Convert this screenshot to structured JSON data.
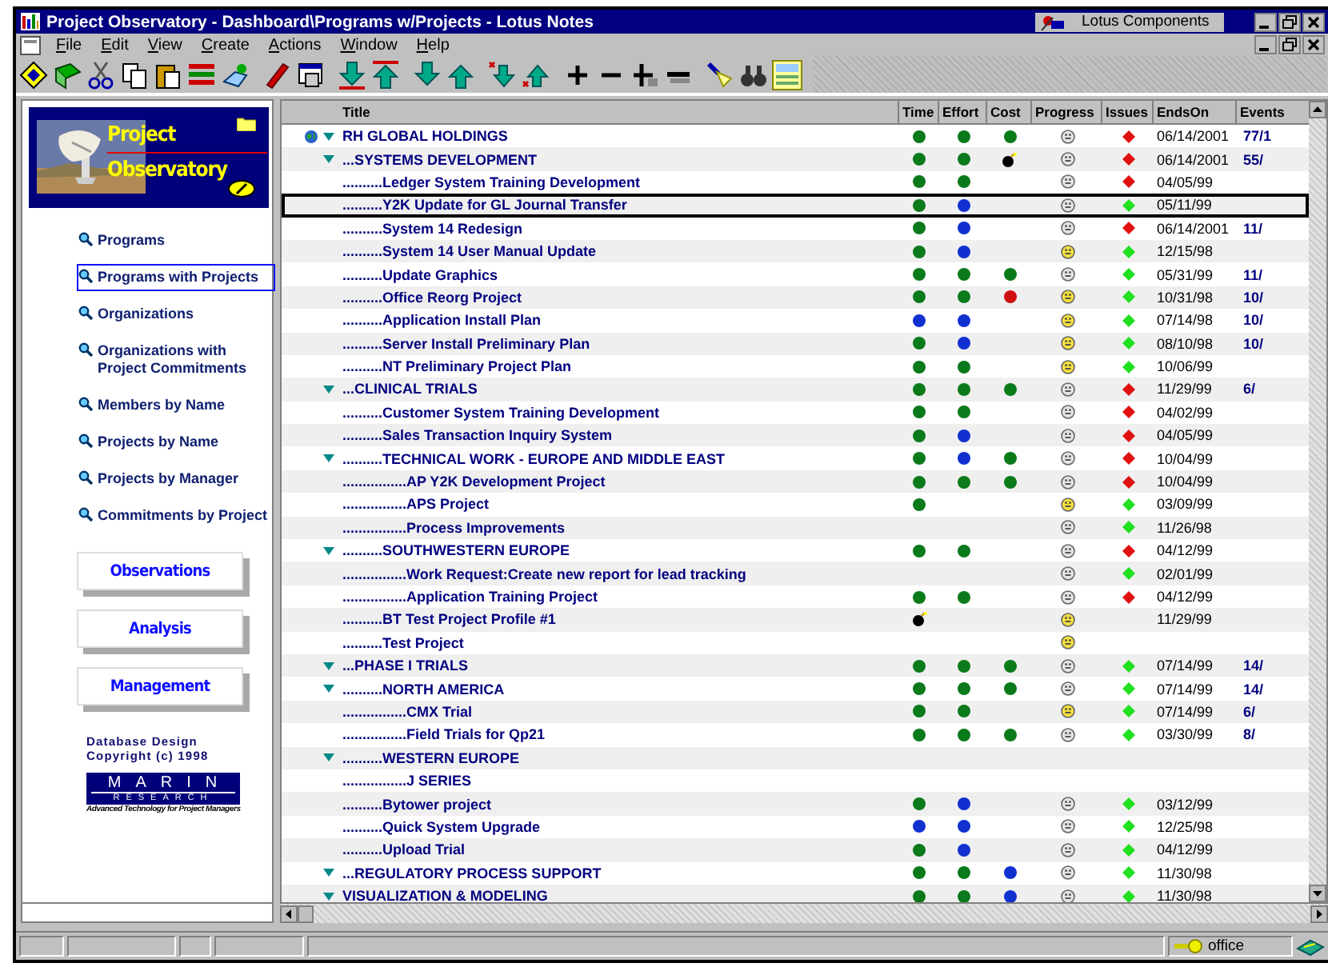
{
  "window": {
    "title": "Project Observatory - Dashboard\\Programs w/Projects - Lotus Notes",
    "component": "Lotus Components"
  },
  "menu": [
    "File",
    "Edit",
    "View",
    "Create",
    "Actions",
    "Window",
    "Help"
  ],
  "sidebar": {
    "banner": {
      "title_1": "Project",
      "title_2": "Observatory"
    },
    "links": [
      {
        "label": "Programs",
        "selected": false
      },
      {
        "label": "Programs with Projects",
        "selected": true
      },
      {
        "label": "Organizations",
        "selected": false
      },
      {
        "label": "Organizations with Project Commitments",
        "selected": false
      },
      {
        "label": "Members by Name",
        "selected": false
      },
      {
        "label": "Projects by Name",
        "selected": false
      },
      {
        "label": "Projects by Manager",
        "selected": false
      },
      {
        "label": "Commitments by Project",
        "selected": false
      }
    ],
    "buttons": [
      "Observations",
      "Analysis",
      "Management"
    ],
    "copyright": [
      "Database Design",
      "Copyright (c) 1998"
    ],
    "logo": {
      "name": "MARIN",
      "subtitle": "RESEARCH",
      "tagline": "Advanced Technology for Project Managers"
    }
  },
  "view": {
    "columns": [
      "Title",
      "Time",
      "Effort",
      "Cost",
      "Progress",
      "Issues",
      "EndsOn",
      "Events"
    ],
    "rows": [
      {
        "title": "RH GLOBAL HOLDINGS",
        "selected": false,
        "expanded": true,
        "time": {
          "kind": "dot",
          "color": "#0a7a1a"
        },
        "effort": {
          "kind": "dot",
          "color": "#0a7a1a"
        },
        "cost": {
          "kind": "dot",
          "color": "#0a7a1a"
        },
        "progress": {
          "color": "#e4e4e4"
        },
        "issues": {
          "color": "#e01010"
        },
        "ends_on": "06/14/2001",
        "events": "77/1",
        "children": [
          {
            "title": "...SYSTEMS DEVELOPMENT",
            "selected": false,
            "expanded": true,
            "time": {
              "kind": "dot",
              "color": "#0a7a1a"
            },
            "effort": {
              "kind": "dot",
              "color": "#0a7a1a"
            },
            "cost": {
              "kind": "bomb"
            },
            "progress": {
              "color": "#e4e4e4"
            },
            "issues": {
              "color": "#e01010"
            },
            "ends_on": "06/14/2001",
            "events": "55/",
            "children": [
              {
                "title": "..........Ledger System Training Development",
                "selected": false,
                "time": {
                  "kind": "dot",
                  "color": "#0a7a1a"
                },
                "effort": {
                  "kind": "dot",
                  "color": "#0a7a1a"
                },
                "progress": {
                  "color": "#e4e4e4"
                },
                "issues": {
                  "color": "#e01010"
                },
                "ends_on": "04/05/99"
              },
              {
                "title": "..........Y2K Update for GL Journal Transfer",
                "selected": true,
                "time": {
                  "kind": "dot",
                  "color": "#0a7a1a"
                },
                "effort": {
                  "kind": "dot",
                  "color": "#1030d0"
                },
                "progress": {
                  "color": "#e4e4e4"
                },
                "issues": {
                  "color": "#20e020"
                },
                "ends_on": "05/11/99"
              },
              {
                "title": "..........System 14 Redesign",
                "selected": false,
                "time": {
                  "kind": "dot",
                  "color": "#0a7a1a"
                },
                "effort": {
                  "kind": "dot",
                  "color": "#1030d0"
                },
                "progress": {
                  "color": "#e4e4e4"
                },
                "issues": {
                  "color": "#e01010"
                },
                "ends_on": "06/14/2001",
                "events": "11/"
              },
              {
                "title": "..........System 14 User Manual Update",
                "selected": false,
                "time": {
                  "kind": "dot",
                  "color": "#0a7a1a"
                },
                "effort": {
                  "kind": "dot",
                  "color": "#1030d0"
                },
                "progress": {
                  "color": "#f4e040"
                },
                "issues": {
                  "color": "#20e020"
                },
                "ends_on": "12/15/98"
              },
              {
                "title": "..........Update Graphics",
                "selected": false,
                "time": {
                  "kind": "dot",
                  "color": "#0a7a1a"
                },
                "effort": {
                  "kind": "dot",
                  "color": "#0a7a1a"
                },
                "cost": {
                  "kind": "dot",
                  "color": "#0a7a1a"
                },
                "progress": {
                  "color": "#e4e4e4"
                },
                "issues": {
                  "color": "#20e020"
                },
                "ends_on": "05/31/99",
                "events": "11/"
              },
              {
                "title": "..........Office Reorg Project",
                "selected": false,
                "time": {
                  "kind": "dot",
                  "color": "#0a7a1a"
                },
                "effort": {
                  "kind": "dot",
                  "color": "#0a7a1a"
                },
                "cost": {
                  "kind": "dot",
                  "color": "#d01010"
                },
                "progress": {
                  "color": "#f4e040"
                },
                "issues": {
                  "color": "#20e020"
                },
                "ends_on": "10/31/98",
                "events": "10/"
              },
              {
                "title": "..........Application Install Plan",
                "selected": false,
                "time": {
                  "kind": "dot",
                  "color": "#1030d0"
                },
                "effort": {
                  "kind": "dot",
                  "color": "#1030d0"
                },
                "progress": {
                  "color": "#f4e040"
                },
                "issues": {
                  "color": "#20e020"
                },
                "ends_on": "07/14/98",
                "events": "10/"
              },
              {
                "title": "..........Server Install Preliminary Plan",
                "selected": false,
                "time": {
                  "kind": "dot",
                  "color": "#0a7a1a"
                },
                "effort": {
                  "kind": "dot",
                  "color": "#1030d0"
                },
                "progress": {
                  "color": "#f4e040"
                },
                "issues": {
                  "color": "#20e020"
                },
                "ends_on": "08/10/98",
                "events": "10/"
              },
              {
                "title": "..........NT Preliminary Project Plan",
                "selected": false,
                "time": {
                  "kind": "dot",
                  "color": "#0a7a1a"
                },
                "effort": {
                  "kind": "dot",
                  "color": "#0a7a1a"
                },
                "progress": {
                  "color": "#f4e040"
                },
                "issues": {
                  "color": "#20e020"
                },
                "ends_on": "10/06/99"
              }
            ]
          },
          {
            "title": "...CLINICAL TRIALS",
            "selected": false,
            "expanded": true,
            "time": {
              "kind": "dot",
              "color": "#0a7a1a"
            },
            "effort": {
              "kind": "dot",
              "color": "#0a7a1a"
            },
            "cost": {
              "kind": "dot",
              "color": "#0a7a1a"
            },
            "progress": {
              "color": "#e4e4e4"
            },
            "issues": {
              "color": "#e01010"
            },
            "ends_on": "11/29/99",
            "events": "6/",
            "children": [
              {
                "title": "..........Customer System Training Development",
                "selected": false,
                "time": {
                  "kind": "dot",
                  "color": "#0a7a1a"
                },
                "effort": {
                  "kind": "dot",
                  "color": "#0a7a1a"
                },
                "progress": {
                  "color": "#e4e4e4"
                },
                "issues": {
                  "color": "#e01010"
                },
                "ends_on": "04/02/99"
              },
              {
                "title": "..........Sales Transaction Inquiry System",
                "selected": false,
                "time": {
                  "kind": "dot",
                  "color": "#0a7a1a"
                },
                "effort": {
                  "kind": "dot",
                  "color": "#1030d0"
                },
                "progress": {
                  "color": "#e4e4e4"
                },
                "issues": {
                  "color": "#e01010"
                },
                "ends_on": "04/05/99"
              },
              {
                "title": "..........TECHNICAL WORK - EUROPE AND MIDDLE EAST",
                "selected": false,
                "expanded": true,
                "time": {
                  "kind": "dot",
                  "color": "#0a7a1a"
                },
                "effort": {
                  "kind": "dot",
                  "color": "#1030d0"
                },
                "cost": {
                  "kind": "dot",
                  "color": "#0a7a1a"
                },
                "progress": {
                  "color": "#e4e4e4"
                },
                "issues": {
                  "color": "#e01010"
                },
                "ends_on": "10/04/99",
                "children": [
                  {
                    "title": "................AP Y2K Development Project",
                    "selected": false,
                    "time": {
                      "kind": "dot",
                      "color": "#0a7a1a"
                    },
                    "effort": {
                      "kind": "dot",
                      "color": "#0a7a1a"
                    },
                    "cost": {
                      "kind": "dot",
                      "color": "#0a7a1a"
                    },
                    "progress": {
                      "color": "#e4e4e4"
                    },
                    "issues": {
                      "color": "#e01010"
                    },
                    "ends_on": "10/04/99"
                  },
                  {
                    "title": "................APS Project",
                    "selected": false,
                    "time": {
                      "kind": "dot",
                      "color": "#0a7a1a"
                    },
                    "progress": {
                      "color": "#f4e040"
                    },
                    "issues": {
                      "color": "#20e020"
                    },
                    "ends_on": "03/09/99"
                  },
                  {
                    "title": "................Process Improvements",
                    "selected": false,
                    "progress": {
                      "color": "#e4e4e4"
                    },
                    "issues": {
                      "color": "#20e020"
                    },
                    "ends_on": "11/26/98"
                  }
                ]
              },
              {
                "title": "..........SOUTHWESTERN EUROPE",
                "selected": false,
                "expanded": true,
                "time": {
                  "kind": "dot",
                  "color": "#0a7a1a"
                },
                "effort": {
                  "kind": "dot",
                  "color": "#0a7a1a"
                },
                "progress": {
                  "color": "#e4e4e4"
                },
                "issues": {
                  "color": "#e01010"
                },
                "ends_on": "04/12/99",
                "children": [
                  {
                    "title": "................Work Request:Create new report for lead tracking",
                    "selected": false,
                    "progress": {
                      "color": "#e4e4e4"
                    },
                    "issues": {
                      "color": "#20e020"
                    },
                    "ends_on": "02/01/99"
                  },
                  {
                    "title": "................Application Training Project",
                    "selected": false,
                    "time": {
                      "kind": "dot",
                      "color": "#0a7a1a"
                    },
                    "effort": {
                      "kind": "dot",
                      "color": "#0a7a1a"
                    },
                    "progress": {
                      "color": "#e4e4e4"
                    },
                    "issues": {
                      "color": "#e01010"
                    },
                    "ends_on": "04/12/99"
                  }
                ]
              },
              {
                "title": "..........BT Test Project Profile #1",
                "selected": false,
                "time": {
                  "kind": "bomb"
                },
                "progress": {
                  "color": "#f4e040"
                },
                "ends_on": "11/29/99"
              },
              {
                "title": "..........Test Project",
                "selected": false,
                "progress": {
                  "color": "#f4e040"
                }
              }
            ]
          },
          {
            "title": "...PHASE I TRIALS",
            "selected": false,
            "expanded": true,
            "time": {
              "kind": "dot",
              "color": "#0a7a1a"
            },
            "effort": {
              "kind": "dot",
              "color": "#0a7a1a"
            },
            "cost": {
              "kind": "dot",
              "color": "#0a7a1a"
            },
            "progress": {
              "color": "#e4e4e4"
            },
            "issues": {
              "color": "#20e020"
            },
            "ends_on": "07/14/99",
            "events": "14/",
            "children": [
              {
                "title": "..........NORTH AMERICA",
                "selected": false,
                "expanded": true,
                "time": {
                  "kind": "dot",
                  "color": "#0a7a1a"
                },
                "effort": {
                  "kind": "dot",
                  "color": "#0a7a1a"
                },
                "cost": {
                  "kind": "dot",
                  "color": "#0a7a1a"
                },
                "progress": {
                  "color": "#e4e4e4"
                },
                "issues": {
                  "color": "#20e020"
                },
                "ends_on": "07/14/99",
                "events": "14/",
                "children": [
                  {
                    "title": "................CMX Trial",
                    "selected": false,
                    "time": {
                      "kind": "dot",
                      "color": "#0a7a1a"
                    },
                    "effort": {
                      "kind": "dot",
                      "color": "#0a7a1a"
                    },
                    "progress": {
                      "color": "#f4e040"
                    },
                    "issues": {
                      "color": "#20e020"
                    },
                    "ends_on": "07/14/99",
                    "events": "6/"
                  },
                  {
                    "title": "................Field Trials for Qp21",
                    "selected": false,
                    "time": {
                      "kind": "dot",
                      "color": "#0a7a1a"
                    },
                    "effort": {
                      "kind": "dot",
                      "color": "#0a7a1a"
                    },
                    "cost": {
                      "kind": "dot",
                      "color": "#0a7a1a"
                    },
                    "progress": {
                      "color": "#e4e4e4"
                    },
                    "issues": {
                      "color": "#20e020"
                    },
                    "ends_on": "03/30/99",
                    "events": "8/"
                  }
                ]
              },
              {
                "title": "..........WESTERN EUROPE",
                "selected": false,
                "expanded": true,
                "children": [
                  {
                    "title": "................J SERIES",
                    "selected": false
                  }
                ]
              },
              {
                "title": "..........Bytower project",
                "selected": false,
                "time": {
                  "kind": "dot",
                  "color": "#0a7a1a"
                },
                "effort": {
                  "kind": "dot",
                  "color": "#1030d0"
                },
                "progress": {
                  "color": "#e4e4e4"
                },
                "issues": {
                  "color": "#20e020"
                },
                "ends_on": "03/12/99"
              },
              {
                "title": "..........Quick System Upgrade",
                "selected": false,
                "time": {
                  "kind": "dot",
                  "color": "#1030d0"
                },
                "effort": {
                  "kind": "dot",
                  "color": "#1030d0"
                },
                "progress": {
                  "color": "#e4e4e4"
                },
                "issues": {
                  "color": "#20e020"
                },
                "ends_on": "12/25/98"
              },
              {
                "title": "..........Upload Trial",
                "selected": false,
                "time": {
                  "kind": "dot",
                  "color": "#0a7a1a"
                },
                "effort": {
                  "kind": "dot",
                  "color": "#1030d0"
                },
                "progress": {
                  "color": "#e4e4e4"
                },
                "issues": {
                  "color": "#20e020"
                },
                "ends_on": "04/12/99"
              }
            ]
          },
          {
            "title": "...REGULATORY PROCESS SUPPORT",
            "selected": false,
            "expanded": true,
            "time": {
              "kind": "dot",
              "color": "#0a7a1a"
            },
            "effort": {
              "kind": "dot",
              "color": "#0a7a1a"
            },
            "cost": {
              "kind": "dot",
              "color": "#1030d0"
            },
            "progress": {
              "color": "#e4e4e4"
            },
            "issues": {
              "color": "#20e020"
            },
            "ends_on": "11/30/98",
            "children": [
              {
                "title": "VISUALIZATION & MODELING",
                "selected": false,
                "expanded": true,
                "time": {
                  "kind": "dot",
                  "color": "#0a7a1a"
                },
                "effort": {
                  "kind": "dot",
                  "color": "#0a7a1a"
                },
                "cost": {
                  "kind": "dot",
                  "color": "#1030d0"
                },
                "progress": {
                  "color": "#e4e4e4"
                },
                "issues": {
                  "color": "#20e020"
                },
                "ends_on": "11/30/98"
              }
            ]
          }
        ]
      }
    ]
  },
  "status_bar": {
    "location": "office"
  }
}
